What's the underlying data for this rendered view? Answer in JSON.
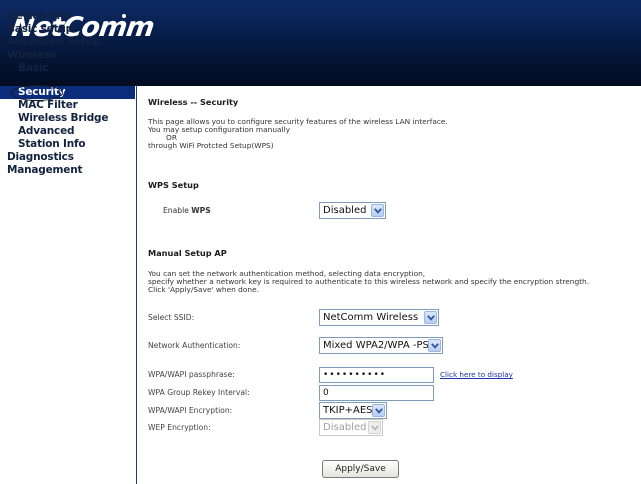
{
  "brand": {
    "logo_text": "NetComm"
  },
  "sidebar": {
    "items": [
      {
        "label": "Device Info",
        "active": false
      },
      {
        "label": "Basic setup",
        "active": false
      },
      {
        "label": "Advanced Setup",
        "active": false
      },
      {
        "label": "Wireless",
        "active": false
      },
      {
        "label": "Basic",
        "active": false
      },
      {
        "label": "Security",
        "active": true
      },
      {
        "label": "MAC Filter",
        "active": false
      },
      {
        "label": "Wireless Bridge",
        "active": false
      },
      {
        "label": "Advanced",
        "active": false
      },
      {
        "label": "Station Info",
        "active": false
      },
      {
        "label": "Diagnostics",
        "active": false
      },
      {
        "label": "Management",
        "active": false
      }
    ]
  },
  "main": {
    "title": "Wireless -- Security",
    "intro": [
      "This page allows you to configure security features of the wireless LAN interface.",
      "You may setup configuration manually",
      "OR",
      "through WiFi Protcted Setup(WPS)"
    ],
    "wps": {
      "heading": "WPS Setup",
      "enable_label_prefix": "Enable ",
      "enable_label_bold": "WPS",
      "enable_value": "Disabled"
    },
    "manual": {
      "heading": "Manual Setup AP",
      "description": [
        "You can set the network authentication method, selecting data encryption,",
        "specify whether a network key is required to authenticate to this wireless network and specify the encryption strength.",
        "Click 'Apply/Save' when done."
      ],
      "ssid_label": "Select SSID:",
      "ssid_value": "NetComm Wireless",
      "auth_label": "Network Authentication:",
      "auth_value": "Mixed WPA2/WPA -PSK",
      "passphrase_label": "WPA/WAPI passphrase:",
      "passphrase_value": "••••••••••",
      "passphrase_link": "Click here to display",
      "rekey_label": "WPA Group Rekey Interval:",
      "rekey_value": "0",
      "encryption_label": "WPA/WAPI Encryption:",
      "encryption_value": "TKIP+AES",
      "wep_label": "WEP Encryption:",
      "wep_value": "Disabled"
    },
    "apply_button": "Apply/Save"
  },
  "colors": {
    "header": "#08204f",
    "nav_active": "#0a2c7a",
    "link": "#1a33aa"
  }
}
